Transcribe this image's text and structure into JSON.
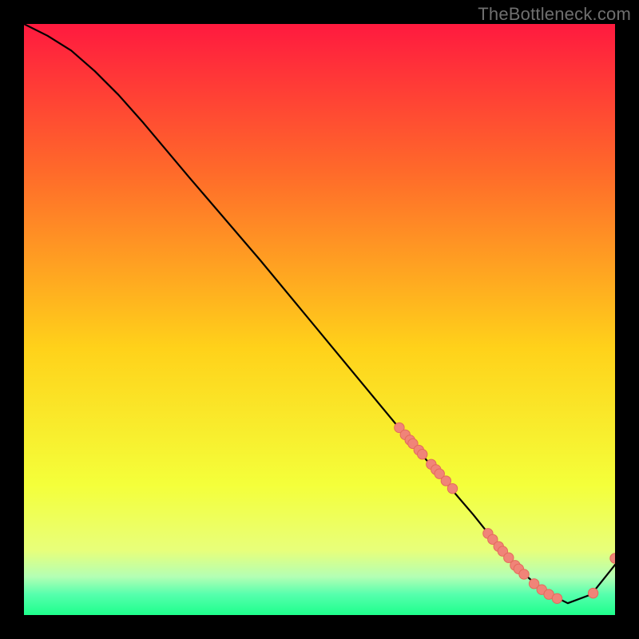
{
  "watermark": "TheBottleneck.com",
  "colors": {
    "background": "#000000",
    "curve": "#000000",
    "point_fill": "#f08478",
    "point_stroke": "#e46a5c",
    "grad_top": "#ff1a3f",
    "grad_mid_upper": "#ff6a2a",
    "grad_mid": "#ffd21a",
    "grad_lower": "#f4ff3a",
    "grad_green_light": "#b4ffb4",
    "grad_green": "#1eff8c"
  },
  "chart_data": {
    "type": "line",
    "title": "",
    "xlabel": "",
    "ylabel": "",
    "xlim": [
      0,
      100
    ],
    "ylim": [
      0,
      100
    ],
    "curve": {
      "x": [
        0,
        4,
        8,
        12,
        16,
        20,
        28,
        40,
        52,
        64,
        70,
        76,
        80,
        84,
        88,
        92,
        96,
        100
      ],
      "y": [
        100,
        98,
        95.5,
        92,
        88,
        83.5,
        74,
        60,
        45.5,
        31,
        24,
        17,
        12,
        7.5,
        4,
        2,
        3.5,
        8.5
      ]
    },
    "points": {
      "x": [
        63.5,
        64.5,
        65.3,
        65.8,
        66.8,
        67.4,
        68.9,
        69.7,
        70.3,
        71.4,
        72.5,
        78.5,
        79.3,
        80.3,
        81.0,
        82.0,
        83.1,
        83.7,
        84.6,
        86.3,
        87.6,
        88.8,
        90.2,
        96.3,
        100.0
      ],
      "y": [
        31.7,
        30.5,
        29.6,
        29.0,
        27.9,
        27.2,
        25.5,
        24.6,
        23.9,
        22.7,
        21.4,
        13.8,
        12.8,
        11.6,
        10.8,
        9.7,
        8.4,
        7.8,
        6.9,
        5.3,
        4.3,
        3.5,
        2.8,
        3.7,
        9.6
      ]
    }
  }
}
